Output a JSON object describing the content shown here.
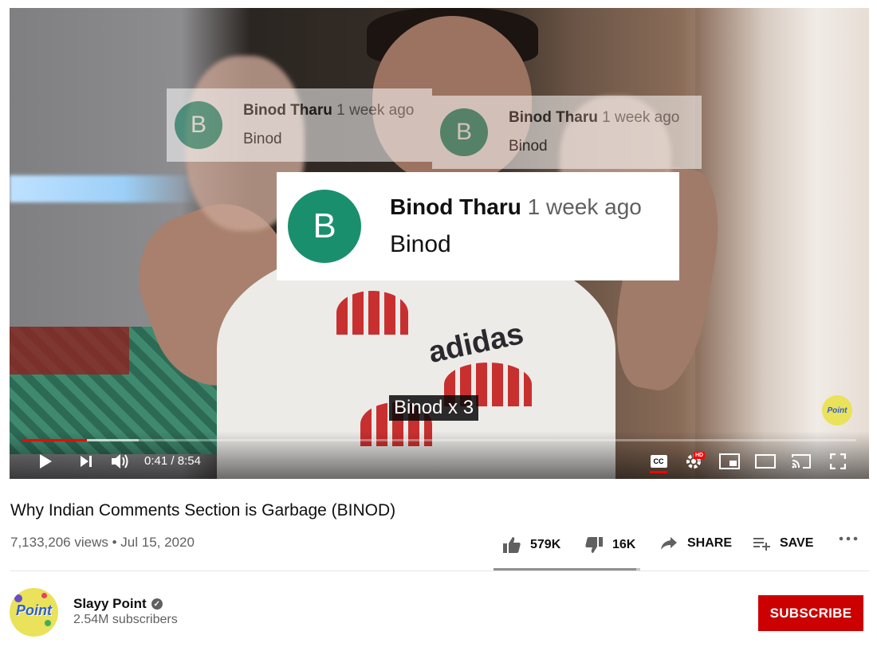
{
  "video": {
    "caption": "Binod x 3",
    "watermark_text": "Point",
    "progress_fraction": 0.0777,
    "time_current": "0:41",
    "time_separator": " / ",
    "time_total": "8:54",
    "overlay_comments": [
      {
        "avatar_letter": "B",
        "author": "Binod Tharu",
        "ago": "1 week ago",
        "text": "Binod"
      },
      {
        "avatar_letter": "B",
        "author": "Binod Tharu",
        "ago": "1 week ago",
        "text": "Binod"
      },
      {
        "avatar_letter": "B",
        "author": "Binod Tharu",
        "ago": "1 week ago",
        "text": "Binod"
      }
    ],
    "controls": {
      "play_icon": "play-icon",
      "next_icon": "next-icon",
      "volume_icon": "volume-icon",
      "cc_label": "CC",
      "hd_badge": "HD"
    },
    "accent_color": "#ff0000"
  },
  "info": {
    "title": "Why Indian Comments Section is Garbage (BINOD)",
    "views": "7,133,206 views",
    "separator": "•",
    "date": "Jul 15, 2020",
    "likes": "579K",
    "dislikes": "16K",
    "share_label": "SHARE",
    "save_label": "SAVE",
    "like_fraction": 0.973
  },
  "channel": {
    "name": "Slayy Point",
    "subscribers": "2.54M subscribers",
    "avatar_text": "Point",
    "subscribe_label": "SUBSCRIBE",
    "subscribe_color": "#cc0000"
  }
}
